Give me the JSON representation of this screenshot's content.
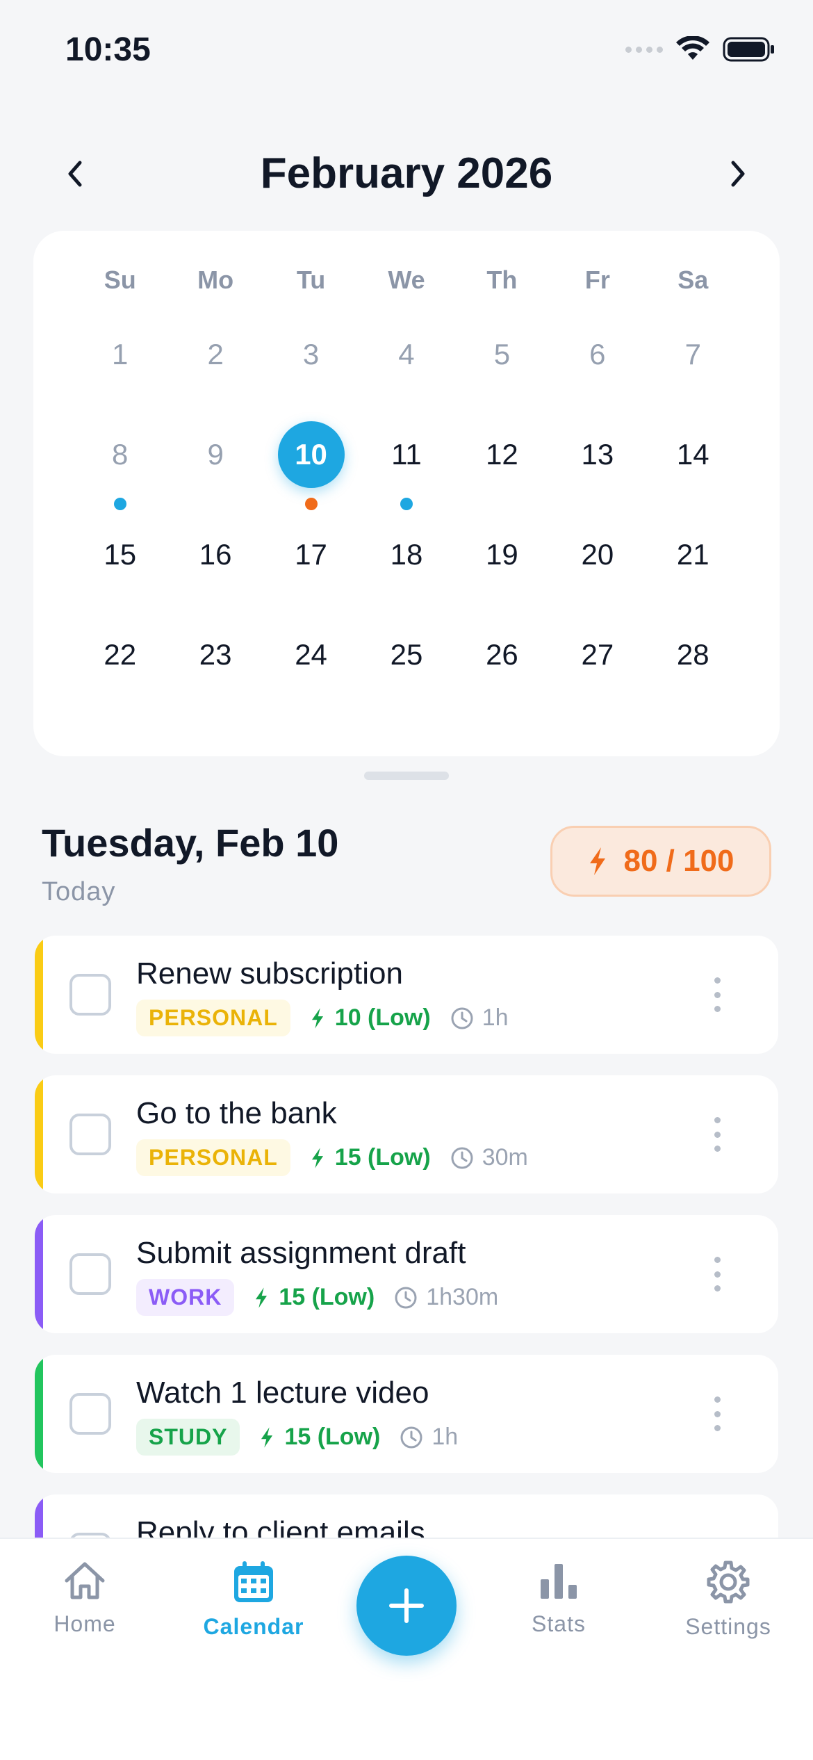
{
  "status": {
    "time": "10:35"
  },
  "calendar": {
    "title": "February 2026",
    "weekdays": [
      "Su",
      "Mo",
      "Tu",
      "We",
      "Th",
      "Fr",
      "Sa"
    ],
    "rows": [
      [
        "1",
        "2",
        "3",
        "4",
        "5",
        "6",
        "7"
      ],
      [
        "8",
        "9",
        "10",
        "11",
        "12",
        "13",
        "14"
      ],
      [
        "15",
        "16",
        "17",
        "18",
        "19",
        "20",
        "21"
      ],
      [
        "22",
        "23",
        "24",
        "25",
        "26",
        "27",
        "28"
      ]
    ],
    "selected_day": "10",
    "colors": {
      "accent": "#1ea7e1",
      "dot_blue": "#1ea7e1",
      "dot_orange": "#f06b1a"
    }
  },
  "day": {
    "heading": "Tuesday, Feb 10",
    "sub": "Today",
    "energy_badge": "80 / 100"
  },
  "tasks": [
    {
      "title": "Renew subscription",
      "tag": "PERSONAL",
      "energy": "10 (Low)",
      "duration": "1h",
      "accent": "#facc15"
    },
    {
      "title": "Go to the bank",
      "tag": "PERSONAL",
      "energy": "15 (Low)",
      "duration": "30m",
      "accent": "#facc15"
    },
    {
      "title": "Submit assignment draft",
      "tag": "WORK",
      "energy": "15 (Low)",
      "duration": "1h30m",
      "accent": "#8b5cf6"
    },
    {
      "title": "Watch 1 lecture video",
      "tag": "STUDY",
      "energy": "15 (Low)",
      "duration": "1h",
      "accent": "#22c55e"
    },
    {
      "title": "Reply to client emails",
      "accent": "#8b5cf6"
    }
  ],
  "tabbar": {
    "home": "Home",
    "calendar": "Calendar",
    "stats": "Stats",
    "settings": "Settings"
  }
}
